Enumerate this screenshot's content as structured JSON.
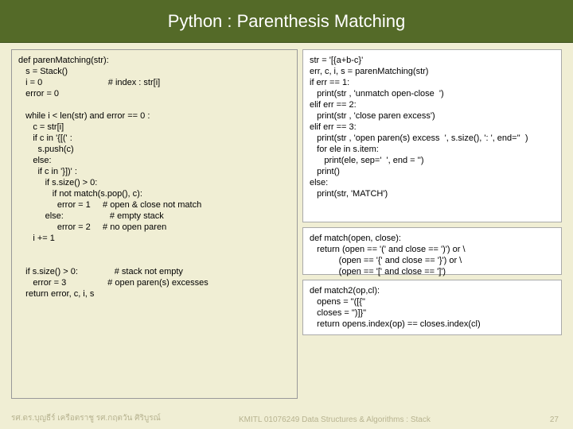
{
  "title": "Python : Parenthesis Matching",
  "code": {
    "boxA": "def parenMatching(str):\n   s = Stack()\n   i = 0                           # index : str[i]\n   error = 0\n\n   while i < len(str) and error == 0 :\n      c = str[i]\n      if c in '{[(' :\n        s.push(c)\n      else:\n        if c in '}])' :\n           if s.size() > 0:\n              if not match(s.pop(), c):\n                error = 1     # open & close not match\n           else:                   # empty stack\n                error = 2     # no open paren\n      i += 1\n\n\n   if s.size() > 0:               # stack not empty\n      error = 3                 # open paren(s) excesses\n   return error, c, i, s",
    "boxB": "str = '[{a+b-c}'\nerr, c, i, s = parenMatching(str)\nif err == 1:\n   print(str , 'unmatch open-close  ')\nelif err == 2:\n   print(str , 'close paren excess')\nelif err == 3:\n   print(str , 'open paren(s) excess  ', s.size(), ': ', end=''  )\n   for ele in s.item:\n      print(ele, sep='  ', end = '')\n   print()\nelse:\n   print(str, 'MATCH')",
    "boxC": "def match(open, close):\n   return (open == '(' and close == ')') or \\\n            (open == '{' and close == '}') or \\\n            (open == '[' and close == ']')",
    "boxD": "def match2(op,cl):\n   opens = \"([{\"\n   closes = \")]}\"\n   return opens.index(op) == closes.index(cl)"
  },
  "footer": {
    "left": "รศ.ดร.บุญธีร์      เครือตราชู      รศ.กฤตวัน   ศิริบูรณ์",
    "mid": "KMITL   01076249 Data Structures & Algorithms : Stack",
    "page": "27"
  }
}
